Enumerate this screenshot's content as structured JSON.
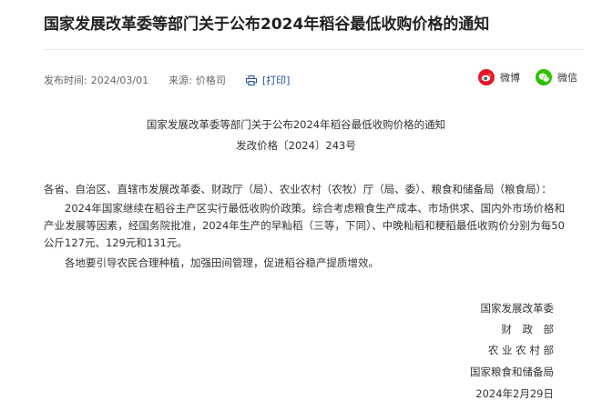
{
  "article": {
    "title": "国家发展改革委等部门关于公布2024年稻谷最低收购价格的通知",
    "publish_label": "发布时间:",
    "publish_date": "2024/03/01",
    "source_label": "来源:",
    "source": "价格司",
    "print_label": "[打印]"
  },
  "share": {
    "weibo_label": "微博",
    "wechat_label": "微信",
    "weibo_color": "#e6162d",
    "wechat_color": "#2dc100"
  },
  "document": {
    "heading": "国家发展改革委等部门关于公布2024年稻谷最低收购价格的通知",
    "doc_number": "发改价格〔2024〕243号",
    "salutation": "各省、自治区、直辖市发展改革委、财政厅（局）、农业农村（农牧）厅（局、委）、粮食和储备局（粮食局）：",
    "paragraphs": [
      "2024年国家继续在稻谷主产区实行最低收购价政策。综合考虑粮食生产成本、市场供求、国内外市场价格和产业发展等因素，经国务院批准，2024年生产的早籼稻（三等，下同）、中晚籼稻和粳稻最低收购价分别为每50公斤127元、129元和131元。",
      "各地要引导农民合理种植，加强田间管理，促进稻谷稳产提质增效。"
    ],
    "signatories": [
      "国家发展改革委",
      "财　政　部",
      "农 业 农 村 部",
      "国家粮食和储备局"
    ],
    "date": "2024年2月29日"
  }
}
